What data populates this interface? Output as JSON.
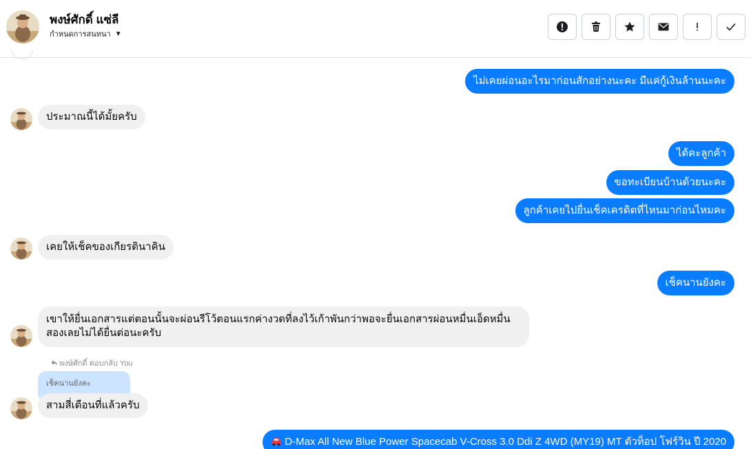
{
  "header": {
    "name": "พงษ์ศักดิ์ แซ่ลี",
    "assign_label": "กำหนดการสนทนา",
    "buttons": [
      {
        "name": "alert-button",
        "icon": "exclamation-circle-icon"
      },
      {
        "name": "delete-button",
        "icon": "trash-icon"
      },
      {
        "name": "star-button",
        "icon": "star-icon"
      },
      {
        "name": "mail-button",
        "icon": "envelope-icon"
      },
      {
        "name": "important-button",
        "icon": "exclamation-icon"
      },
      {
        "name": "done-button",
        "icon": "check-icon"
      }
    ]
  },
  "messages": {
    "m1": "ไม่เคยผ่อนอะไรมาก่อนสักอย่างนะคะ มีแค่กู้เงินล้านนะคะ",
    "m2": "ประมาณนี้ได้มั้ยครับ",
    "m3": "ได้คะลูกค้า",
    "m4": "ขอทะเบียนบ้านด้วยนะคะ",
    "m5": "ลูกค้าเคยไปยื่นเช็คเครดิตที่ไหนมาก่อนไหมคะ",
    "m6": "เคยให้เช็คของเกียรตินาคิน",
    "m7": "เช็คนานยังคะ",
    "m8": "เขาให้ยื่นเอกสารแต่ตอนนั้นจะผ่อนรีโว้ตอนแรกค่างวดที่ลงไว้เก้าพันกว่าพอจะยื่นเอกสารผ่อนหมื่นเอ็ดหมื่นสองเลยไม่ได้ยื่นต่อนะครับ",
    "reply_meta": "พงษ์ศักดิ์ ตอบกลับ You",
    "reply_quote": "เช็คนานยังคะ",
    "m9": "สามสี่เดือนที่แล้วครับ",
    "m10": "D-Max All New Blue Power Spacecab V-Cross 3.0 Ddi Z 4WD (MY19) MT ตัวท็อป โฟร์วิน ปี 2020"
  },
  "colors": {
    "outgoing_bubble": "#0a7cff",
    "incoming_bubble": "#f0f0f0",
    "reply_quote": "#cce4ff"
  }
}
